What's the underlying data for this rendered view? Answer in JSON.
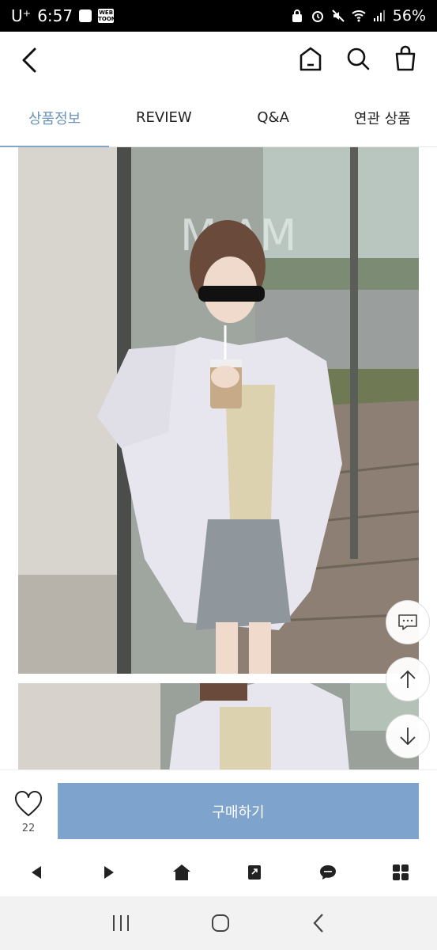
{
  "status_bar": {
    "carrier": "U⁺",
    "time": "6:57",
    "battery": "56%"
  },
  "header": {
    "icons": [
      "back-icon",
      "home-icon",
      "search-icon",
      "shopping-bag-icon"
    ]
  },
  "tabs": [
    {
      "label": "상품정보",
      "active": true
    },
    {
      "label": "REVIEW",
      "active": false
    },
    {
      "label": "Q&A",
      "active": false
    },
    {
      "label": "연관 상품",
      "active": false
    }
  ],
  "product_images": [
    "photo-1",
    "photo-2"
  ],
  "floating_buttons": [
    "chat-icon",
    "arrow-up-icon",
    "arrow-down-icon"
  ],
  "buy_bar": {
    "like_count": "22",
    "buy_label": "구매하기"
  },
  "colors": {
    "accent": "#7ea3cc",
    "active_tab": "#6b93b7"
  }
}
